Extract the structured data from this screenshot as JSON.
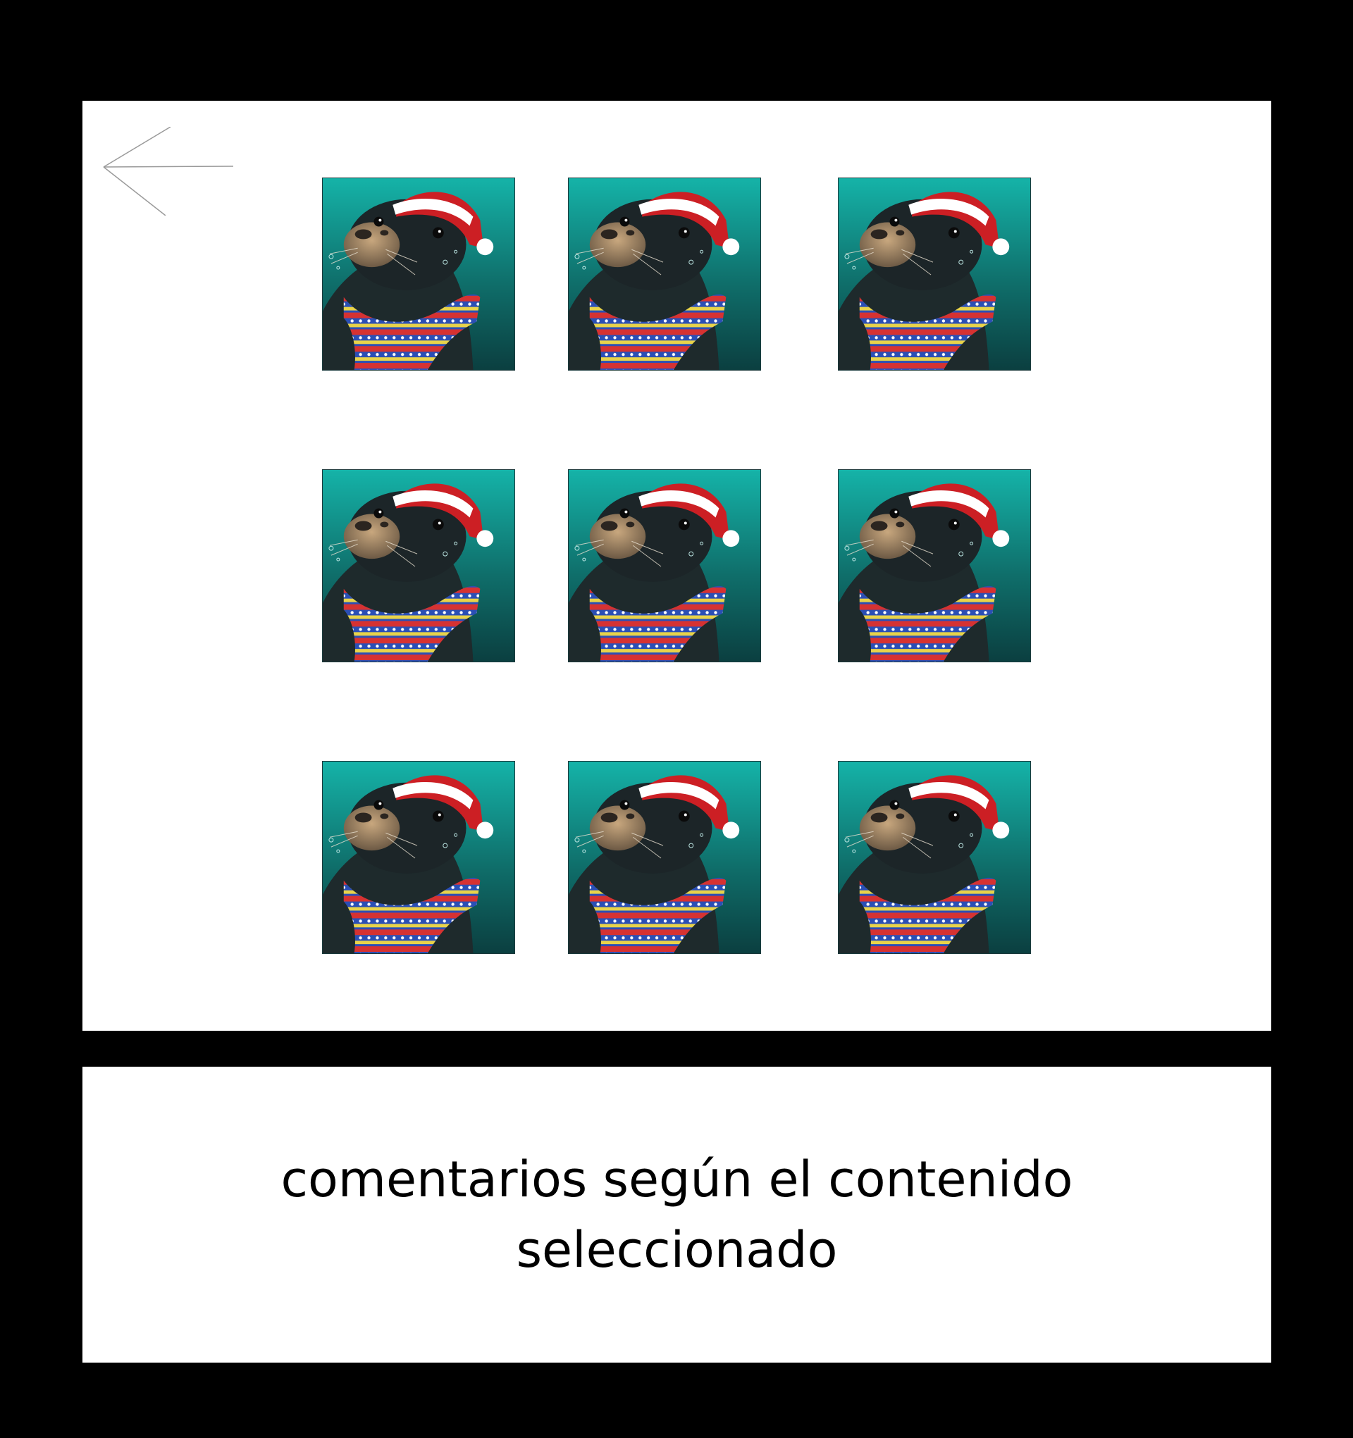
{
  "screen": {
    "background_color": "#000000",
    "panel_color": "#ffffff"
  },
  "toolbar": {
    "back_icon": "arrow-left-icon"
  },
  "gallery": {
    "image_subject": "seal wearing santa hat and scarf",
    "items": [
      {
        "row": 1,
        "col": 1
      },
      {
        "row": 1,
        "col": 2
      },
      {
        "row": 1,
        "col": 3
      },
      {
        "row": 2,
        "col": 1
      },
      {
        "row": 2,
        "col": 2
      },
      {
        "row": 2,
        "col": 3
      },
      {
        "row": 3,
        "col": 1
      },
      {
        "row": 3,
        "col": 2
      },
      {
        "row": 3,
        "col": 3
      }
    ]
  },
  "comments": {
    "text": "comentarios según el contenido seleccionado"
  }
}
